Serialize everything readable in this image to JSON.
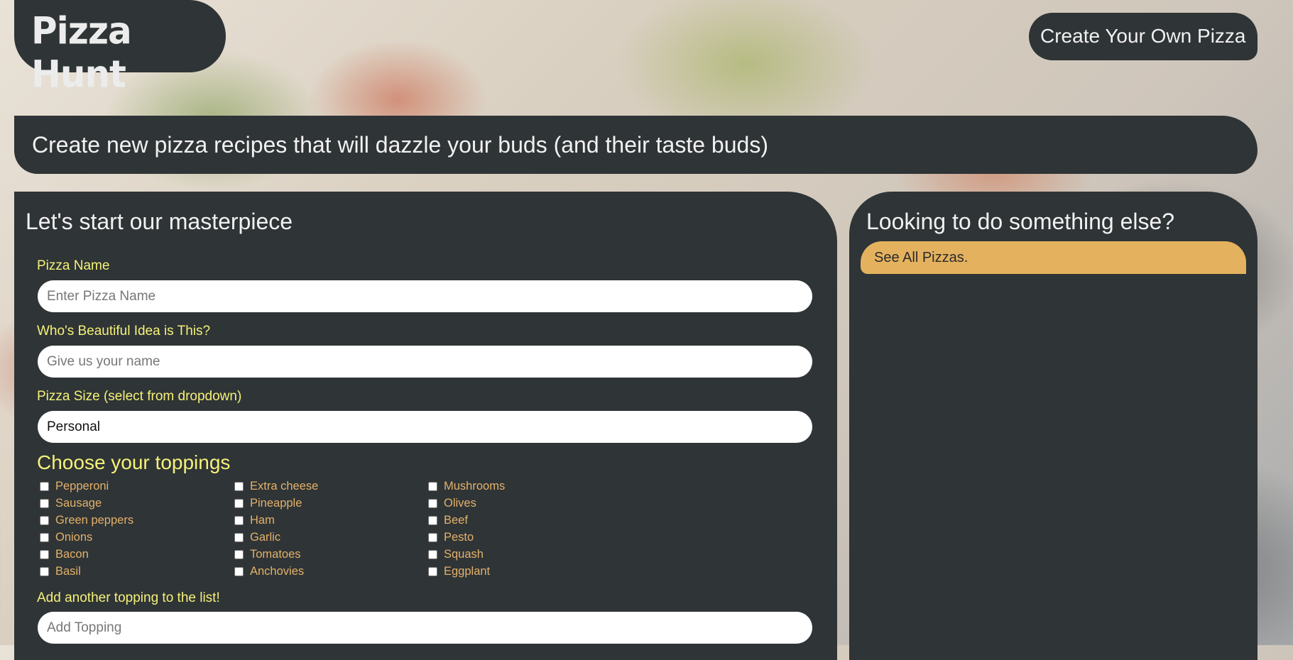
{
  "brand": {
    "logo_text": "Pizza Hunt"
  },
  "header": {
    "create_button": "Create Your Own Pizza"
  },
  "tagline": "Create new pizza recipes that will dazzle your buds (and their taste buds)",
  "form": {
    "title": "Let's start our masterpiece",
    "pizza_name": {
      "label": "Pizza Name",
      "placeholder": "Enter Pizza Name",
      "value": ""
    },
    "creator": {
      "label": "Who's Beautiful Idea is This?",
      "placeholder": "Give us your name",
      "value": ""
    },
    "size": {
      "label": "Pizza Size (select from dropdown)",
      "value": "Personal"
    },
    "toppings": {
      "title": "Choose your toppings",
      "columns": [
        [
          "Pepperoni",
          "Sausage",
          "Green peppers",
          "Onions",
          "Bacon",
          "Basil"
        ],
        [
          "Extra cheese",
          "Pineapple",
          "Ham",
          "Garlic",
          "Tomatoes",
          "Anchovies"
        ],
        [
          "Mushrooms",
          "Olives",
          "Beef",
          "Pesto",
          "Squash",
          "Eggplant"
        ]
      ]
    },
    "add_topping": {
      "label": "Add another topping to the list!",
      "placeholder": "Add Topping",
      "value": ""
    }
  },
  "sidebar": {
    "title": "Looking to do something else?",
    "see_all_button": "See All Pizzas."
  }
}
